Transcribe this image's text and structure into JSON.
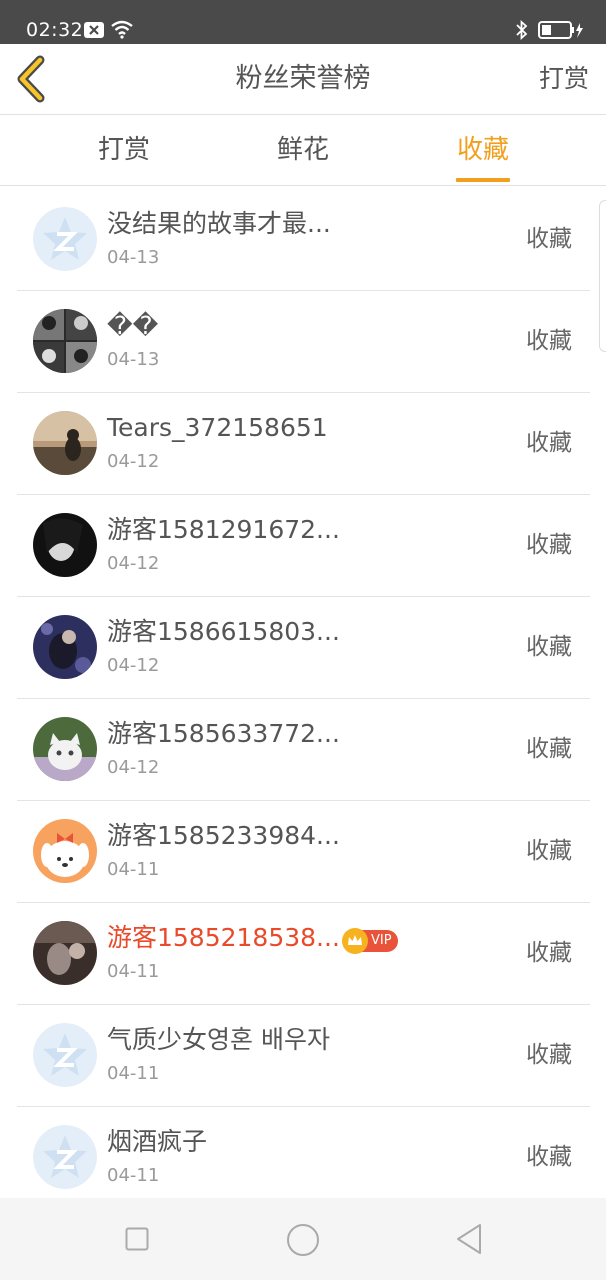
{
  "status_bar": {
    "time": "02:32",
    "icons": [
      "notification-x-icon",
      "wifi-icon",
      "bluetooth-icon",
      "battery-charging-icon"
    ]
  },
  "header": {
    "back_icon": "chevron-left-icon",
    "title": "粉丝荣誉榜",
    "right_action": "打赏"
  },
  "tabs": [
    {
      "label": "打赏",
      "active": false
    },
    {
      "label": "鲜花",
      "active": false
    },
    {
      "label": "收藏",
      "active": true
    }
  ],
  "colors": {
    "accent": "#f0a01e",
    "vip_name": "#e84a2a",
    "status_bar": "#4a4a4a"
  },
  "list": {
    "items": [
      {
        "name": "没结果的故事才最...",
        "date": "04-13",
        "action": "收藏",
        "avatar": "default-avatar",
        "vip": false
      },
      {
        "name": "��",
        "date": "04-13",
        "action": "收藏",
        "avatar": "photo-grid-avatar",
        "vip": false
      },
      {
        "name": "Tears_372158651",
        "date": "04-12",
        "action": "收藏",
        "avatar": "sunset-silhouette-avatar",
        "vip": false
      },
      {
        "name": "游客1581291672...",
        "date": "04-12",
        "action": "收藏",
        "avatar": "dark-portrait-avatar",
        "vip": false
      },
      {
        "name": "游客1586615803...",
        "date": "04-12",
        "action": "收藏",
        "avatar": "couple-night-avatar",
        "vip": false
      },
      {
        "name": "游客1585633772...",
        "date": "04-12",
        "action": "收藏",
        "avatar": "white-cat-avatar",
        "vip": false
      },
      {
        "name": "游客1585233984...",
        "date": "04-11",
        "action": "收藏",
        "avatar": "cartoon-dog-avatar",
        "vip": false
      },
      {
        "name": "游客1585218538...",
        "date": "04-11",
        "action": "收藏",
        "avatar": "dark-photo-avatar",
        "vip": true,
        "vip_label": "VIP"
      },
      {
        "name": "气质少女영혼 배우자",
        "date": "04-11",
        "action": "收藏",
        "avatar": "default-avatar",
        "vip": false
      },
      {
        "name": "烟酒疯子",
        "date": "04-11",
        "action": "收藏",
        "avatar": "default-avatar",
        "vip": false
      }
    ]
  },
  "nav_bar": {
    "icons": [
      "recent-apps-icon",
      "home-icon",
      "back-triangle-icon"
    ]
  }
}
